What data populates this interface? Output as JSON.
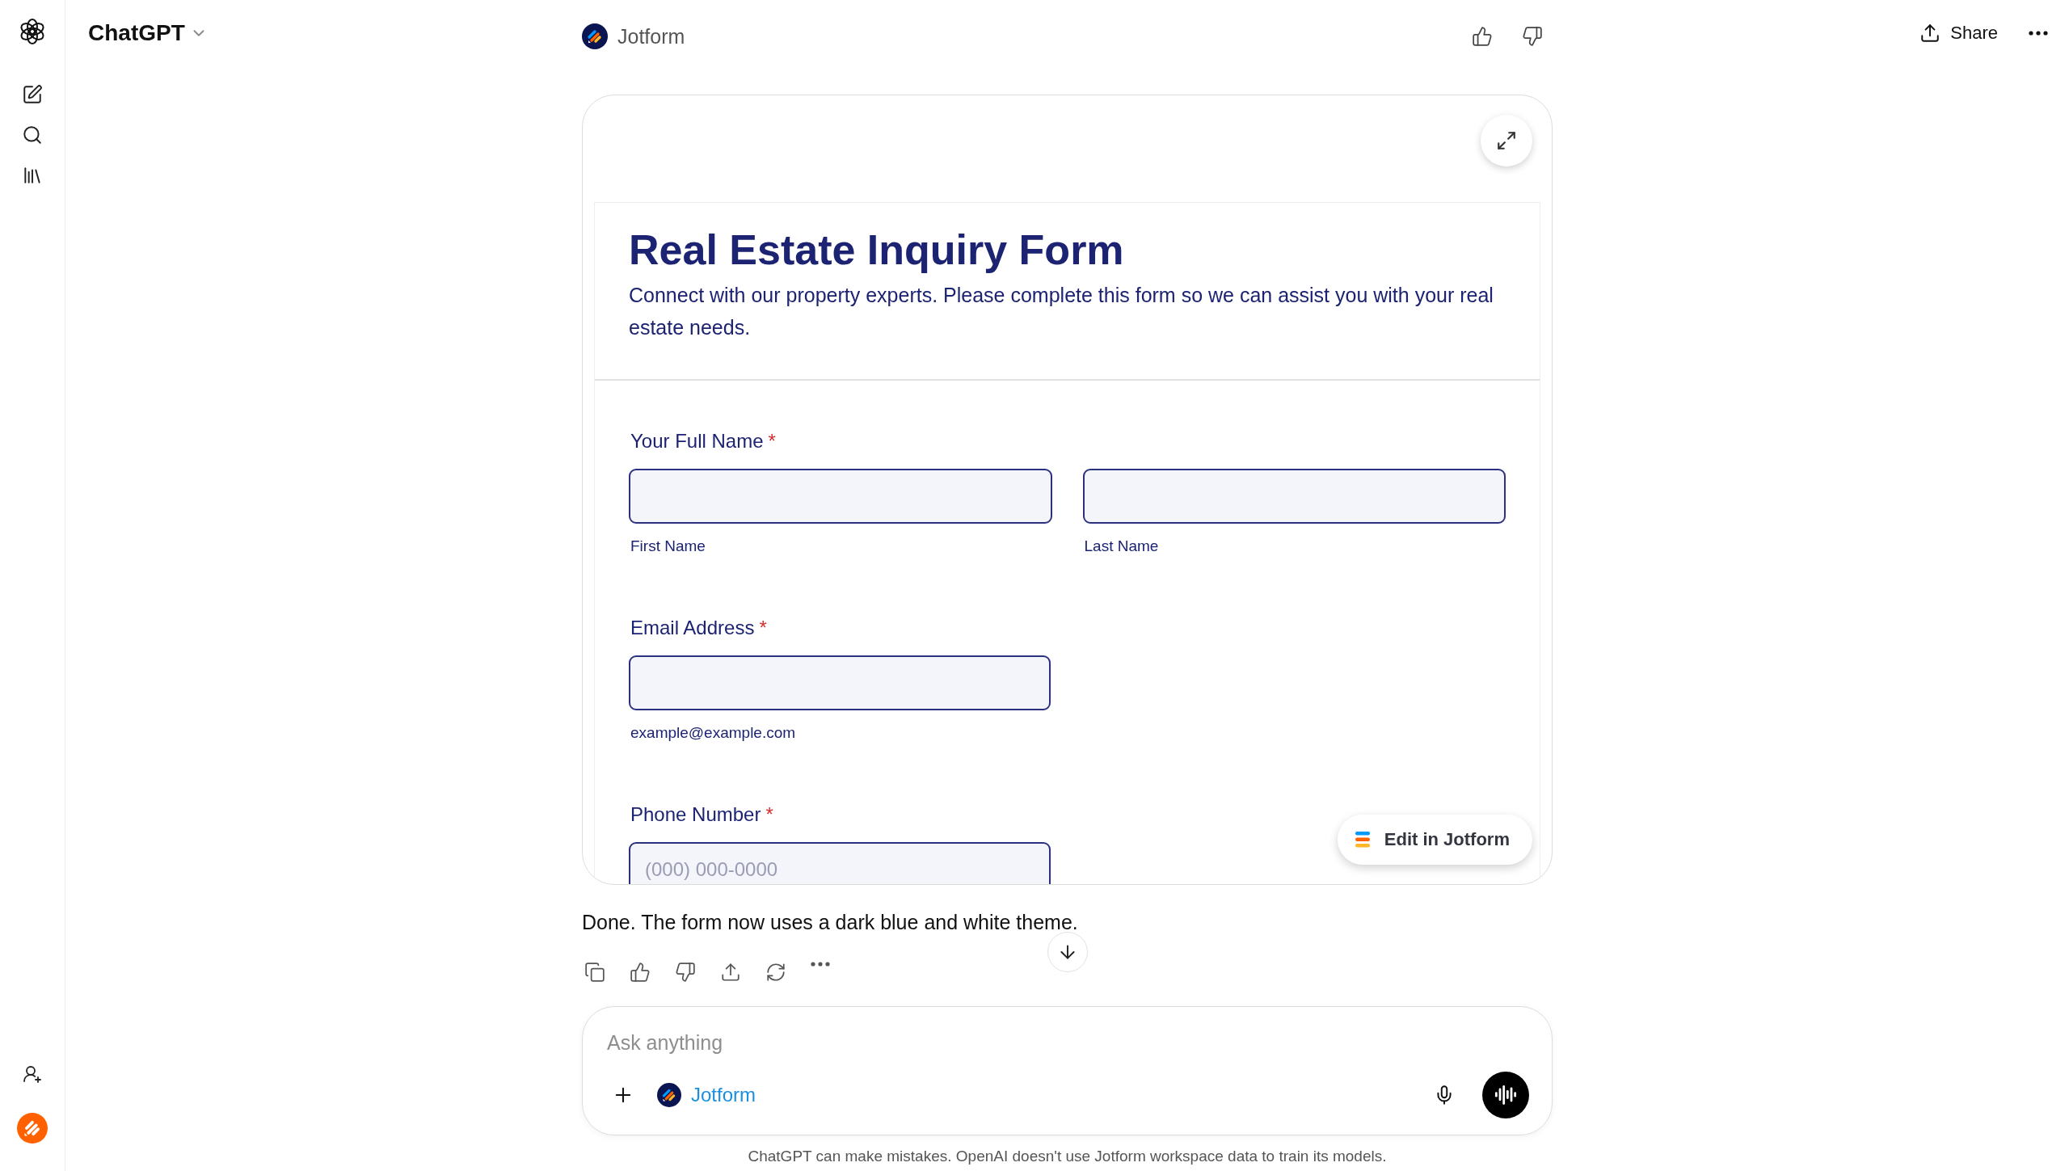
{
  "header": {
    "model": "ChatGPT",
    "app": "Jotform",
    "share": "Share"
  },
  "form": {
    "title": "Real Estate Inquiry Form",
    "description": "Connect with our property experts. Please complete this form so we can assist you with your real estate needs.",
    "fields": [
      {
        "label": "Your Full Name",
        "required_mark": "*",
        "inputs": [
          {
            "sublabel": "First Name"
          },
          {
            "sublabel": "Last Name"
          }
        ]
      },
      {
        "label": "Email Address",
        "required_mark": "*",
        "inputs": [
          {
            "sublabel": "example@example.com"
          }
        ]
      },
      {
        "label": "Phone Number",
        "required_mark": "*",
        "inputs": [
          {
            "placeholder": "(000) 000-0000"
          }
        ]
      }
    ],
    "edit_button": "Edit in Jotform"
  },
  "message": "Done. The form now uses a dark blue and white theme.",
  "composer": {
    "placeholder": "Ask anything",
    "tool": "Jotform"
  },
  "footer": "ChatGPT can make mistakes. OpenAI doesn't use Jotform workspace data to train its models."
}
